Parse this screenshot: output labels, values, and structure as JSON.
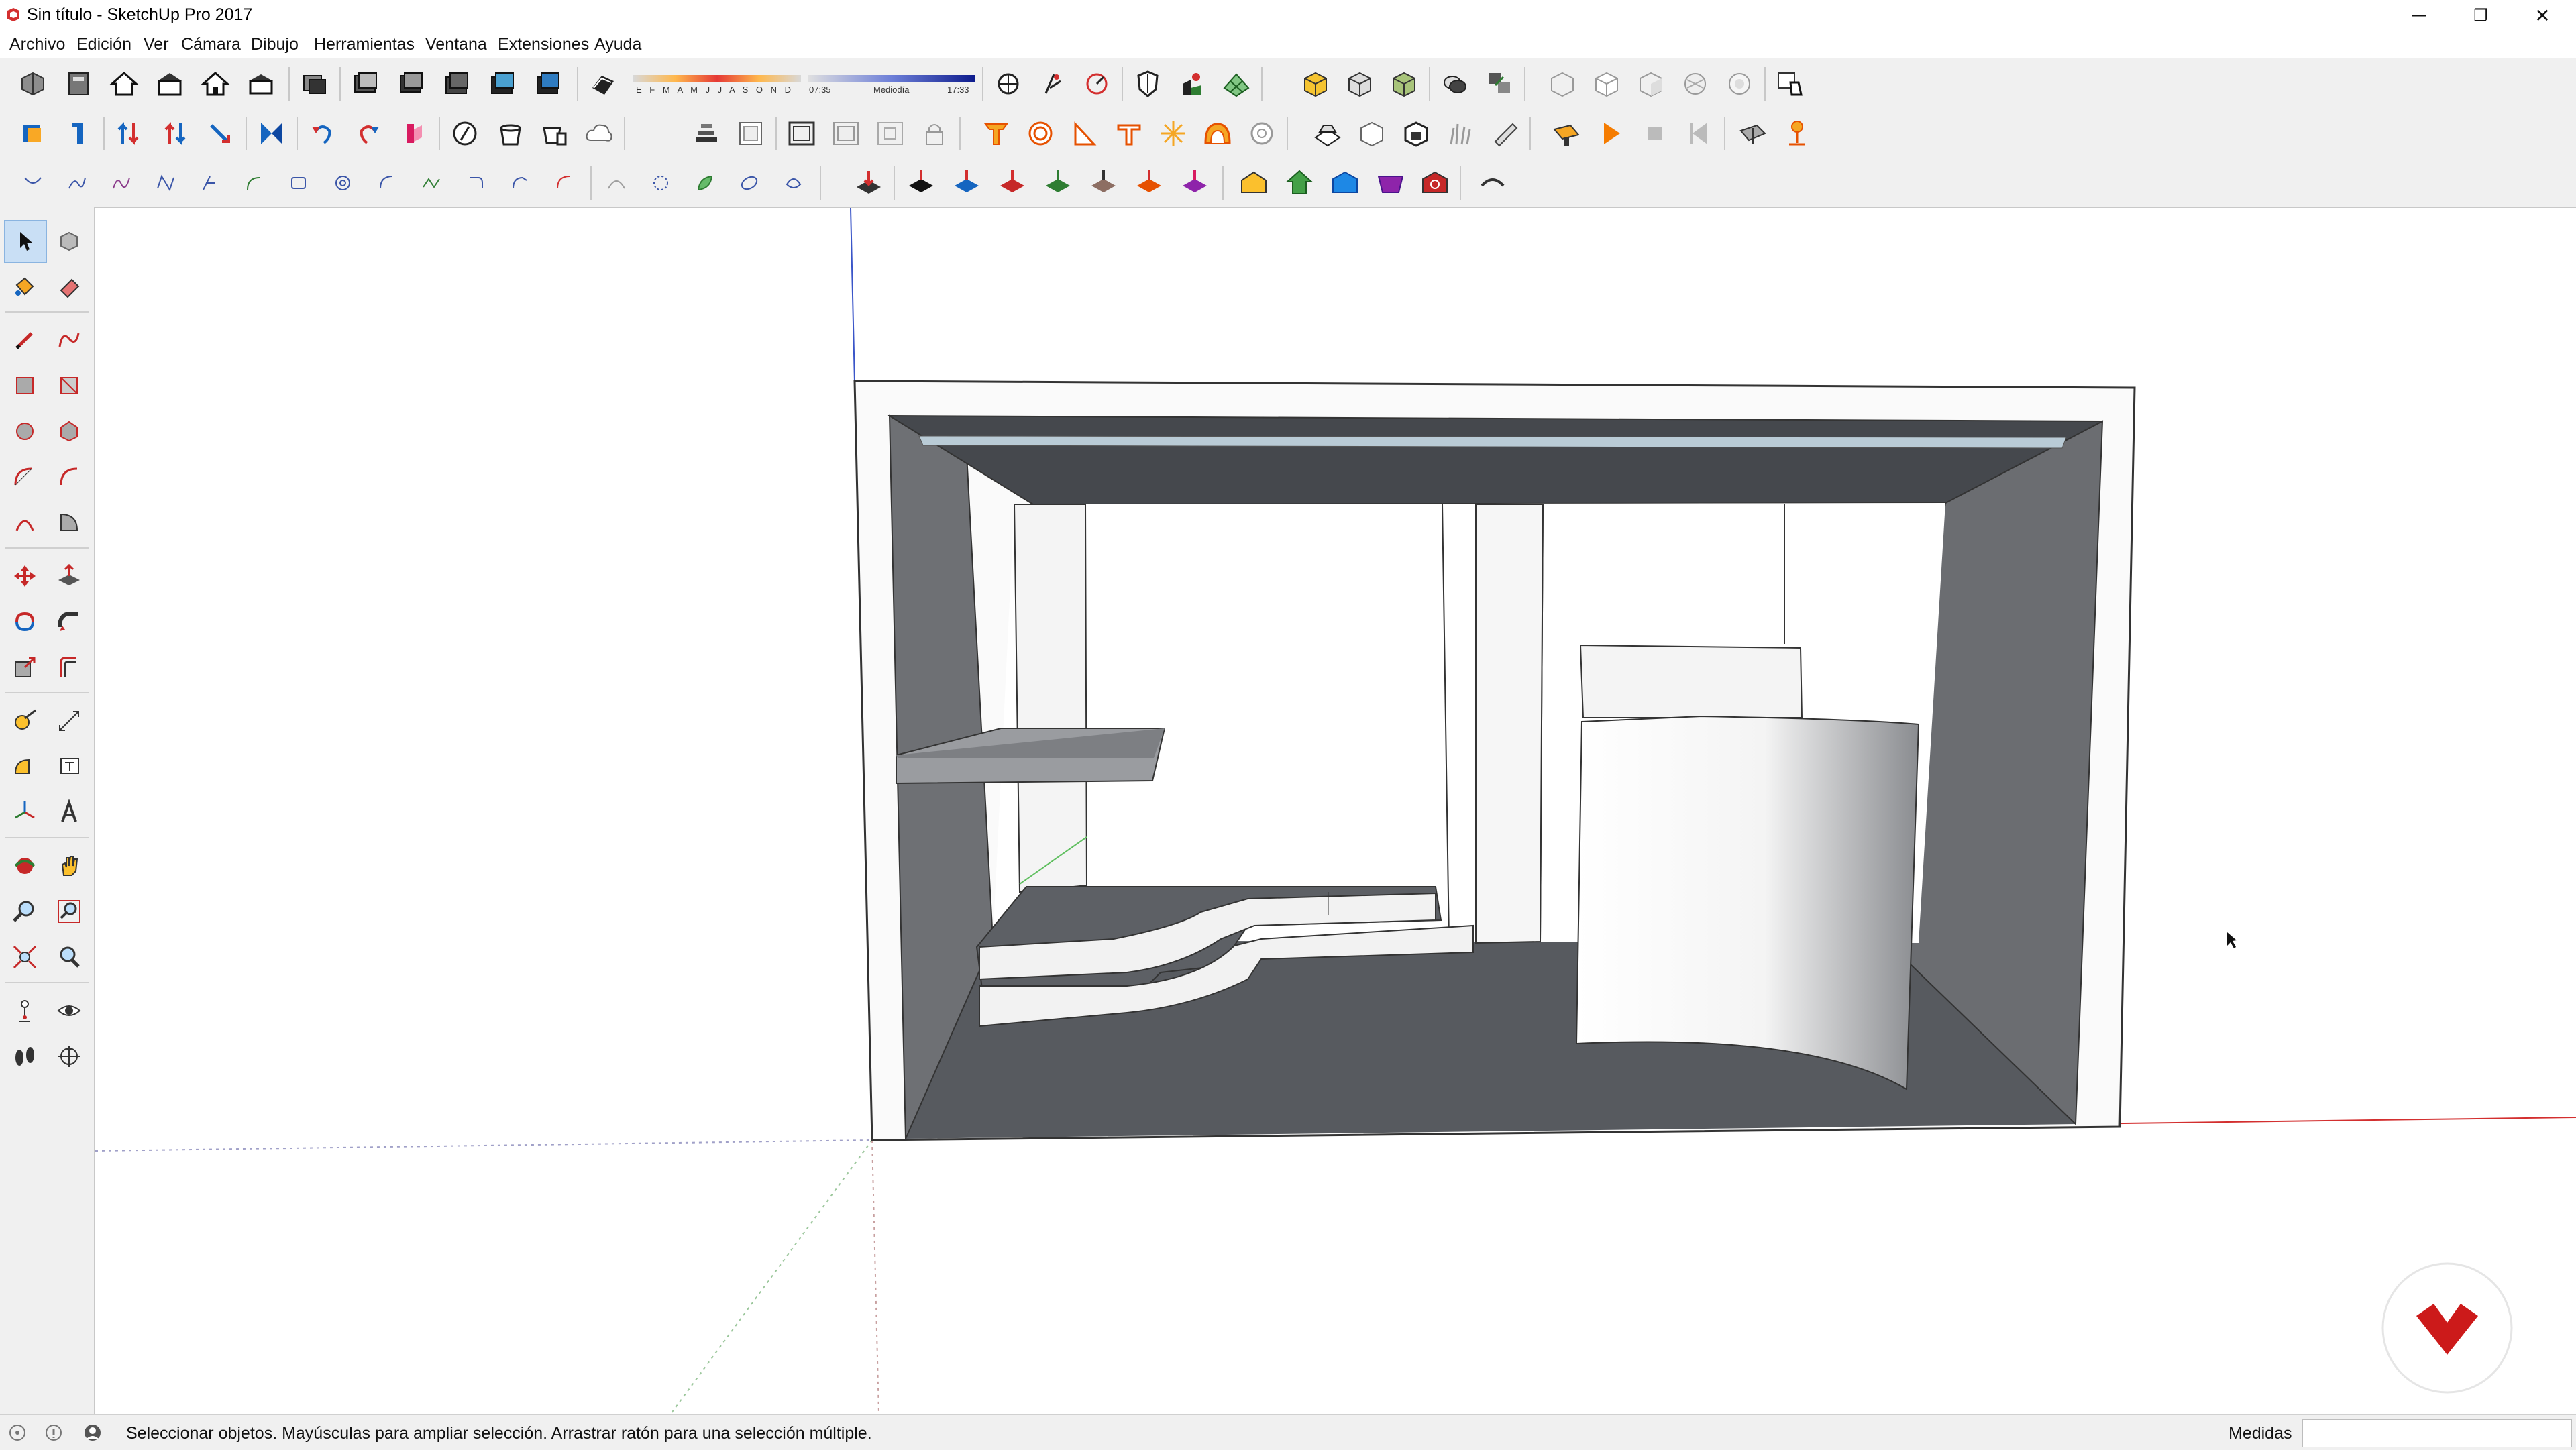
{
  "window": {
    "title": "Sin título - SketchUp Pro 2017",
    "controls": {
      "minimize": "─",
      "restore": "❐",
      "close": "✕"
    }
  },
  "menu": {
    "items": [
      "Archivo",
      "Edición",
      "Ver",
      "Cámara",
      "Dibujo",
      "Herramientas",
      "Ventana",
      "Extensiones",
      "Ayuda"
    ]
  },
  "shadows": {
    "months": "E F M A M J J A S O N D",
    "time_start": "07:35",
    "time_mid": "Mediodía",
    "time_end": "17:33"
  },
  "status": {
    "message": "Seleccionar objetos. Mayúsculas para ampliar selección. Arrastrar ratón para una selección múltiple.",
    "measure_label": "Medidas",
    "measure_value": ""
  },
  "colors": {
    "accent_red": "#cc1a1a",
    "toolbar_bg": "#f0f0f0",
    "model_dark": "#4a4c50",
    "model_wall": "#6a6c70"
  }
}
